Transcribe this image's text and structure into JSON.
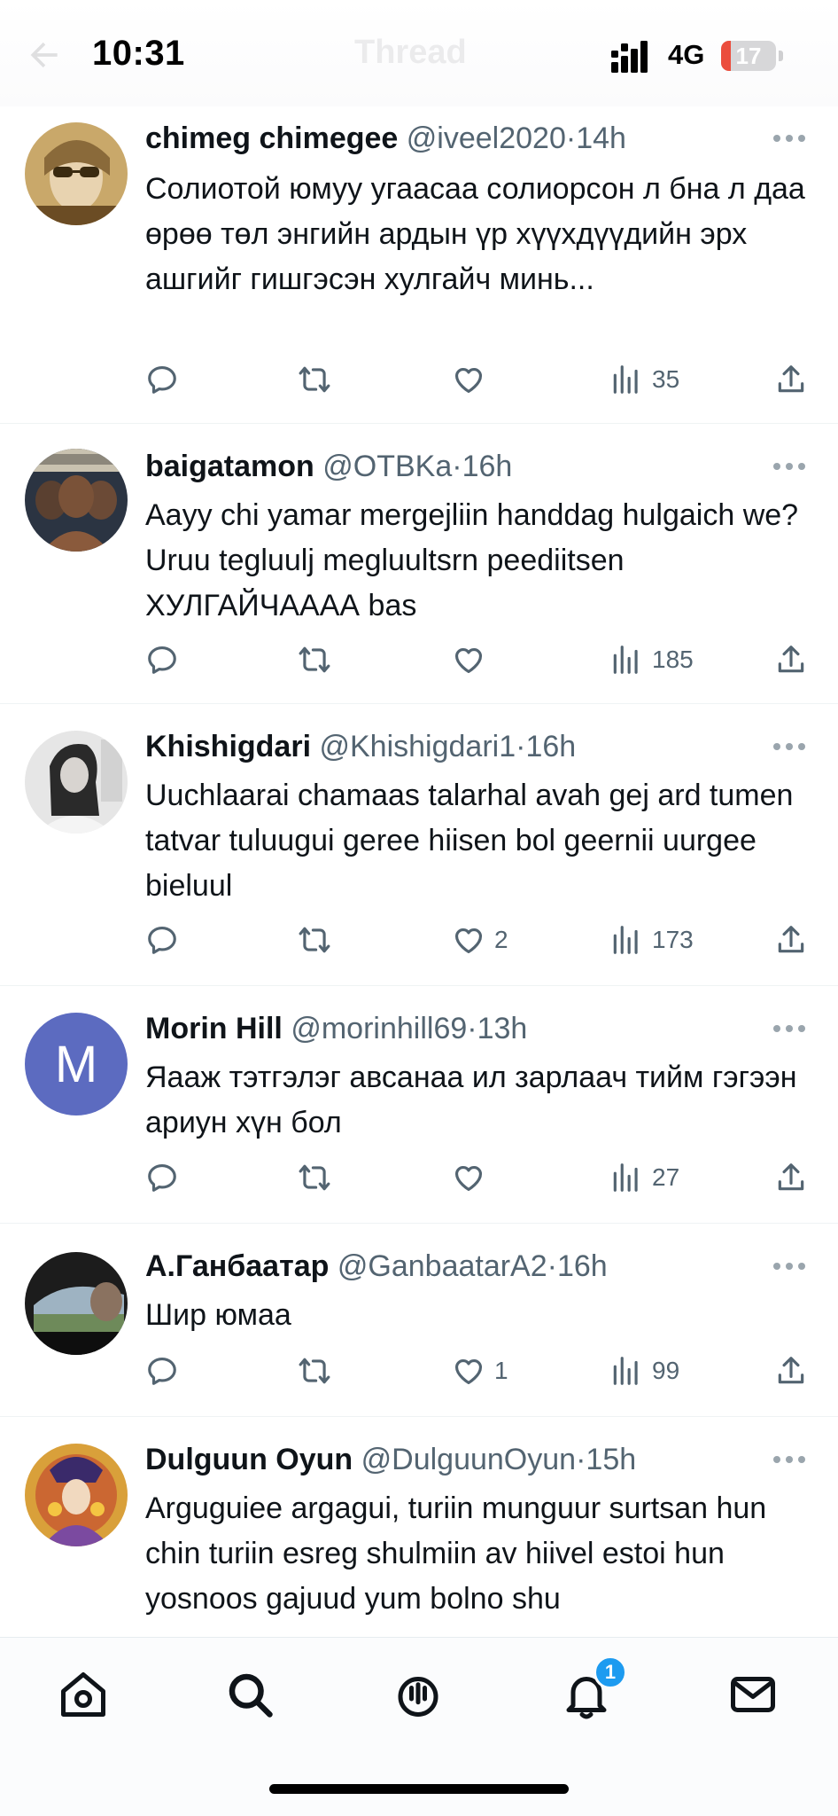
{
  "status_bar": {
    "time": "10:31",
    "network": "4G",
    "battery": "17",
    "battery_level": 0.17,
    "battery_color": "#eb4d3d"
  },
  "header": {
    "title": "Thread"
  },
  "replies": [
    {
      "name": "chimeg chimegee",
      "handle": "@iveel2020",
      "separator": "·",
      "time": "14h",
      "text": "Солиотой юмуу угаасаа солиорсон л бна л даа өрөө төл энгийн ардын үр хүүхдүүдийн эрх ашгийг гишгэсэн хулгайч минь...",
      "replies": "",
      "reposts": "",
      "likes": "",
      "views": "35",
      "avatar_icon": "portrait-with-sunglasses"
    },
    {
      "name": "baigatamon",
      "handle": "@OTBKa",
      "separator": "·",
      "time": "16h",
      "text": "Aayy chi yamar mergejliin handdag hulgaich we? Uruu tegluulj megluultsrn peediitsen ХУЛГАЙЧАААА bas",
      "replies": "",
      "reposts": "",
      "likes": "",
      "views": "185",
      "avatar_icon": "rappers-album-cover"
    },
    {
      "name": "Khishigdari",
      "handle": "@Khishigdari1",
      "separator": "·",
      "time": "16h",
      "text": "Uuchlaarai chamaas talarhal avah gej ard tumen tatvar tuluugui geree hiisen bol geernii uurgee bieluul",
      "replies": "",
      "reposts": "",
      "likes": "2",
      "views": "173",
      "avatar_icon": "grayscale-portrait"
    },
    {
      "name": "Morin Hill",
      "handle": "@morinhill69",
      "separator": "·",
      "time": "13h",
      "text": "Яааж тэтгэлэг авсанаа ил зарлаач тийм гэгээн ариун хүн бол",
      "replies": "",
      "reposts": "",
      "likes": "",
      "views": "27",
      "avatar_letter": "M",
      "avatar_color": "#5c6bc0"
    },
    {
      "name": "А.Ганбаатар",
      "handle": "@GanbaatarA2",
      "separator": "·",
      "time": "16h",
      "text": "Шир юмаа",
      "replies": "",
      "reposts": "",
      "likes": "1",
      "views": "99",
      "avatar_icon": "car-window-landscape"
    },
    {
      "name": "Dulguun Oyun",
      "handle": "@DulguunOyun",
      "separator": "·",
      "time": "15h",
      "text": "Arguguiee argagui, turiin munguur surtsan hun chin turiin esreg shulmiin av hiivel estoi hun yosnoos gajuud yum bolno shu",
      "avatar_icon": "mongolian-queen-painting"
    }
  ],
  "tabbar": {
    "tabs": [
      {
        "icon": "home-icon"
      },
      {
        "icon": "search-icon"
      },
      {
        "icon": "spaces-icon"
      },
      {
        "icon": "notifications-icon",
        "badge": "1"
      },
      {
        "icon": "messages-icon"
      }
    ],
    "accent": "#1d9bf0"
  }
}
